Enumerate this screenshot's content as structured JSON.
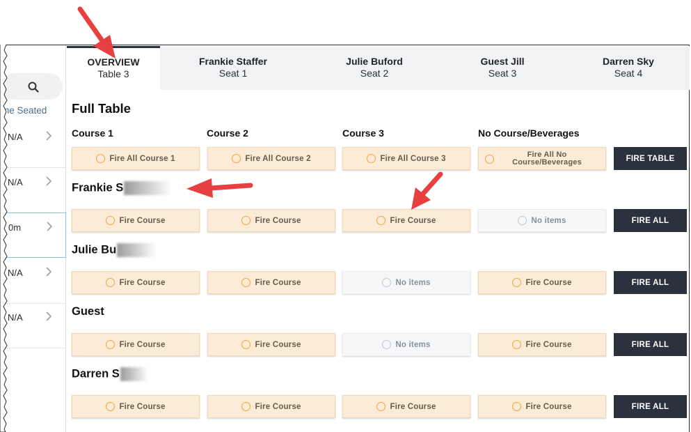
{
  "left_list": {
    "time_seated_label": "me Seated",
    "rows": [
      {
        "value": "N/A"
      },
      {
        "value": "N/A"
      },
      {
        "value": "0m"
      },
      {
        "value": "N/A"
      },
      {
        "value": "N/A"
      }
    ]
  },
  "tabs": [
    {
      "title": "OVERVIEW",
      "sub": "Table 3"
    },
    {
      "title": "Frankie Staffer",
      "sub": "Seat 1"
    },
    {
      "title": "Julie Buford",
      "sub": "Seat 2"
    },
    {
      "title": "Guest Jill",
      "sub": "Seat 3"
    },
    {
      "title": "Darren Sky",
      "sub": "Seat 4"
    }
  ],
  "full_table": {
    "title": "Full Table",
    "courses": [
      "Course 1",
      "Course 2",
      "Course 3",
      "No Course/Beverages"
    ],
    "buttons": [
      "Fire All Course 1",
      "Fire All Course 2",
      "Fire All Course 3"
    ],
    "no_course_button": [
      "Fire All No",
      "Course/Beverages"
    ],
    "fire_table_label": "FIRE TABLE"
  },
  "guests": [
    {
      "name": "Frankie S",
      "buttons": [
        "Fire Course",
        "Fire Course",
        "Fire Course",
        "No items"
      ],
      "fire_all": "FIRE ALL"
    },
    {
      "name": "Julie Bu",
      "buttons": [
        "Fire Course",
        "Fire Course",
        "No items",
        "Fire Course"
      ],
      "fire_all": "FIRE ALL"
    },
    {
      "name": "Guest",
      "buttons": [
        "Fire Course",
        "Fire Course",
        "No items",
        "Fire Course"
      ],
      "fire_all": "FIRE ALL"
    },
    {
      "name": "Darren S",
      "buttons": [
        "Fire Course",
        "Fire Course",
        "Fire Course",
        "Fire Course"
      ],
      "fire_all": "FIRE ALL"
    }
  ],
  "colors": {
    "accent_orange": "#f2a43a",
    "fire_button_bg": "#fcebd6",
    "dark_button_bg": "#2b323d",
    "annotation_arrow": "#ee3b3b"
  }
}
